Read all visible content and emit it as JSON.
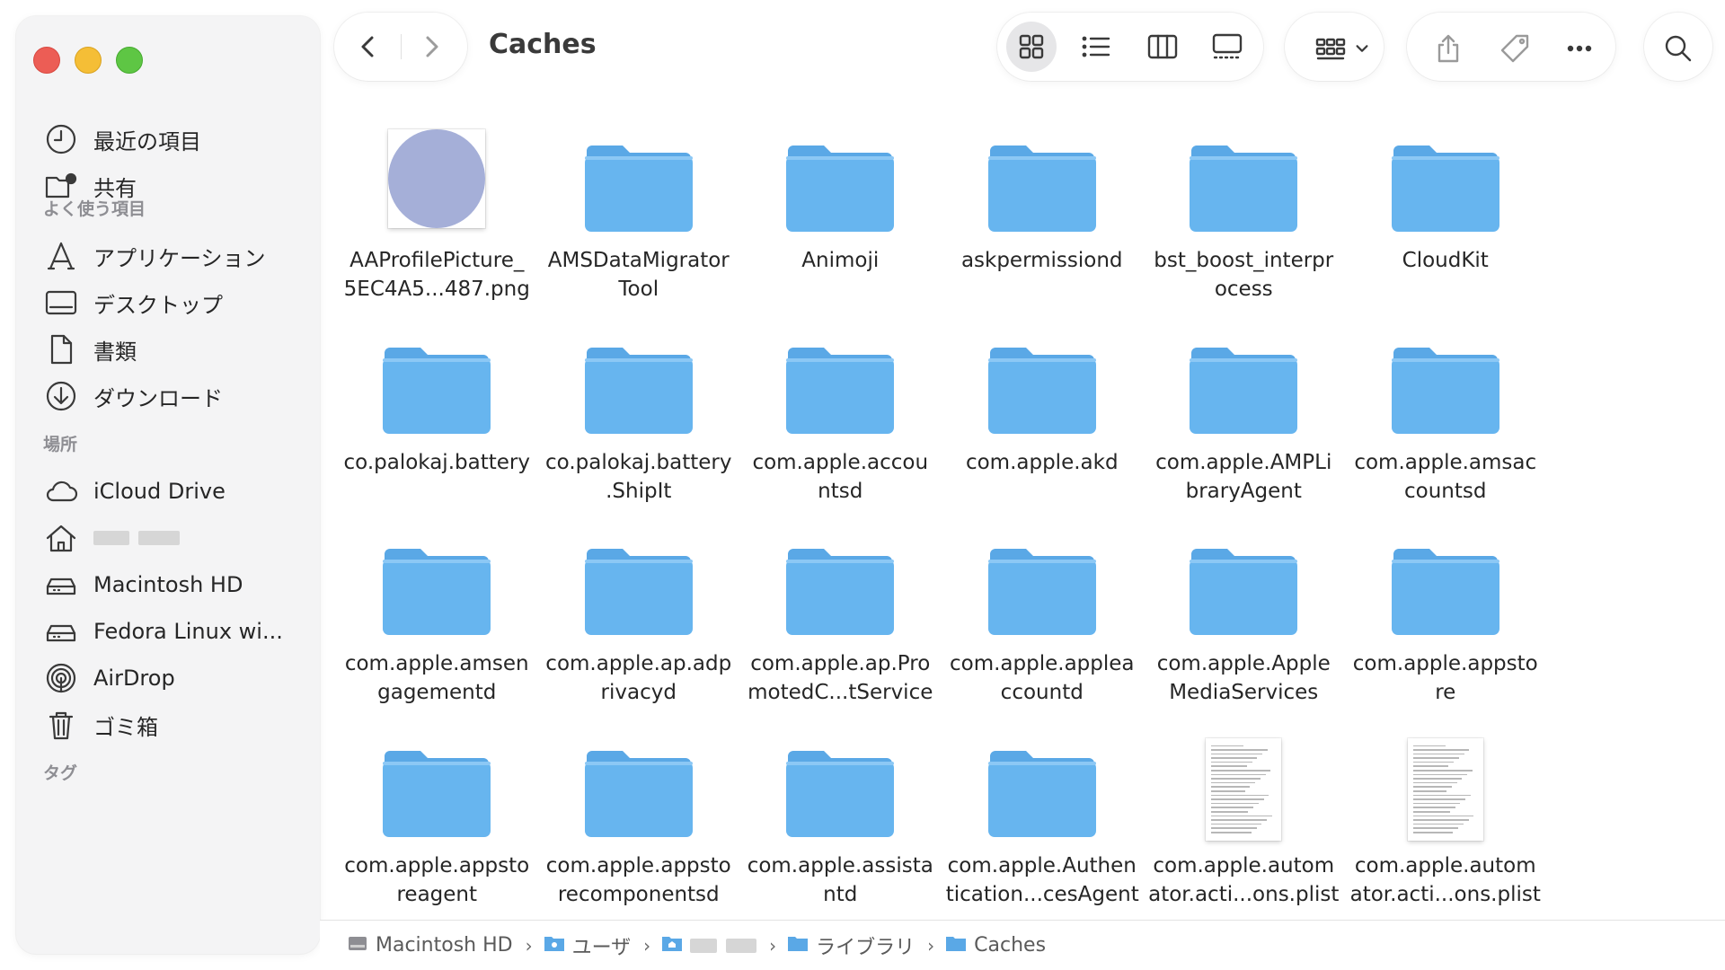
{
  "window": {
    "title": "Caches"
  },
  "sidebar": {
    "recents": [
      {
        "label": "最近の項目",
        "icon": "clock-icon"
      },
      {
        "label": "共有",
        "icon": "shared-folder-icon"
      }
    ],
    "favorites_header": "よく使う項目",
    "favorites": [
      {
        "label": "アプリケーション",
        "icon": "applications-icon"
      },
      {
        "label": "デスクトップ",
        "icon": "desktop-icon"
      },
      {
        "label": "書類",
        "icon": "document-icon"
      },
      {
        "label": "ダウンロード",
        "icon": "download-icon"
      }
    ],
    "locations_header": "場所",
    "locations": [
      {
        "label": "iCloud Drive",
        "icon": "cloud-icon"
      },
      {
        "label": "",
        "icon": "home-icon"
      },
      {
        "label": "Macintosh HD",
        "icon": "drive-icon"
      },
      {
        "label": "Fedora Linux wi...",
        "icon": "drive-icon"
      },
      {
        "label": "AirDrop",
        "icon": "airdrop-icon"
      },
      {
        "label": "ゴミ箱",
        "icon": "trash-icon"
      }
    ],
    "tags_header": "タグ"
  },
  "items": [
    {
      "name": "AAProfilePicture_\n5EC4A5...487.png",
      "kind": "png"
    },
    {
      "name": "AMSDataMigrator\nTool",
      "kind": "folder"
    },
    {
      "name": "Animoji",
      "kind": "folder"
    },
    {
      "name": "askpermissiond",
      "kind": "folder"
    },
    {
      "name": "bst_boost_interpr\nocess",
      "kind": "folder"
    },
    {
      "name": "CloudKit",
      "kind": "folder"
    },
    {
      "name": "co.palokaj.battery",
      "kind": "folder"
    },
    {
      "name": "co.palokaj.battery\n.ShipIt",
      "kind": "folder"
    },
    {
      "name": "com.apple.accou\nntsd",
      "kind": "folder"
    },
    {
      "name": "com.apple.akd",
      "kind": "folder"
    },
    {
      "name": "com.apple.AMPLi\nbraryAgent",
      "kind": "folder"
    },
    {
      "name": "com.apple.amsac\ncountsd",
      "kind": "folder"
    },
    {
      "name": "com.apple.amsen\ngagementd",
      "kind": "folder"
    },
    {
      "name": "com.apple.ap.adp\nrivacyd",
      "kind": "folder"
    },
    {
      "name": "com.apple.ap.Pro\nmotedC...tService",
      "kind": "folder"
    },
    {
      "name": "com.apple.applea\nccountd",
      "kind": "folder"
    },
    {
      "name": "com.apple.Apple\nMediaServices",
      "kind": "folder"
    },
    {
      "name": "com.apple.appsto\nre",
      "kind": "folder"
    },
    {
      "name": "com.apple.appsto\nreagent",
      "kind": "folder"
    },
    {
      "name": "com.apple.appsto\nrecomponentsd",
      "kind": "folder"
    },
    {
      "name": "com.apple.assista\nntd",
      "kind": "folder"
    },
    {
      "name": "com.apple.Authen\ntication...cesAgent",
      "kind": "folder"
    },
    {
      "name": "com.apple.autom\nator.acti...ons.plist",
      "kind": "plist"
    },
    {
      "name": "com.apple.autom\nator.acti...ons.plist",
      "kind": "plist"
    }
  ],
  "pathbar": [
    {
      "label": "Macintosh HD",
      "icon": "drive-icon"
    },
    {
      "label": "ユーザ",
      "icon": "users-folder-icon"
    },
    {
      "label": "",
      "icon": "home-folder-icon"
    },
    {
      "label": "ライブラリ",
      "icon": "folder-icon"
    },
    {
      "label": "Caches",
      "icon": "folder-icon"
    }
  ],
  "colors": {
    "folder_body": "#67b5ef",
    "folder_tab": "#5aa8e6",
    "accent": "#1a8cff"
  }
}
